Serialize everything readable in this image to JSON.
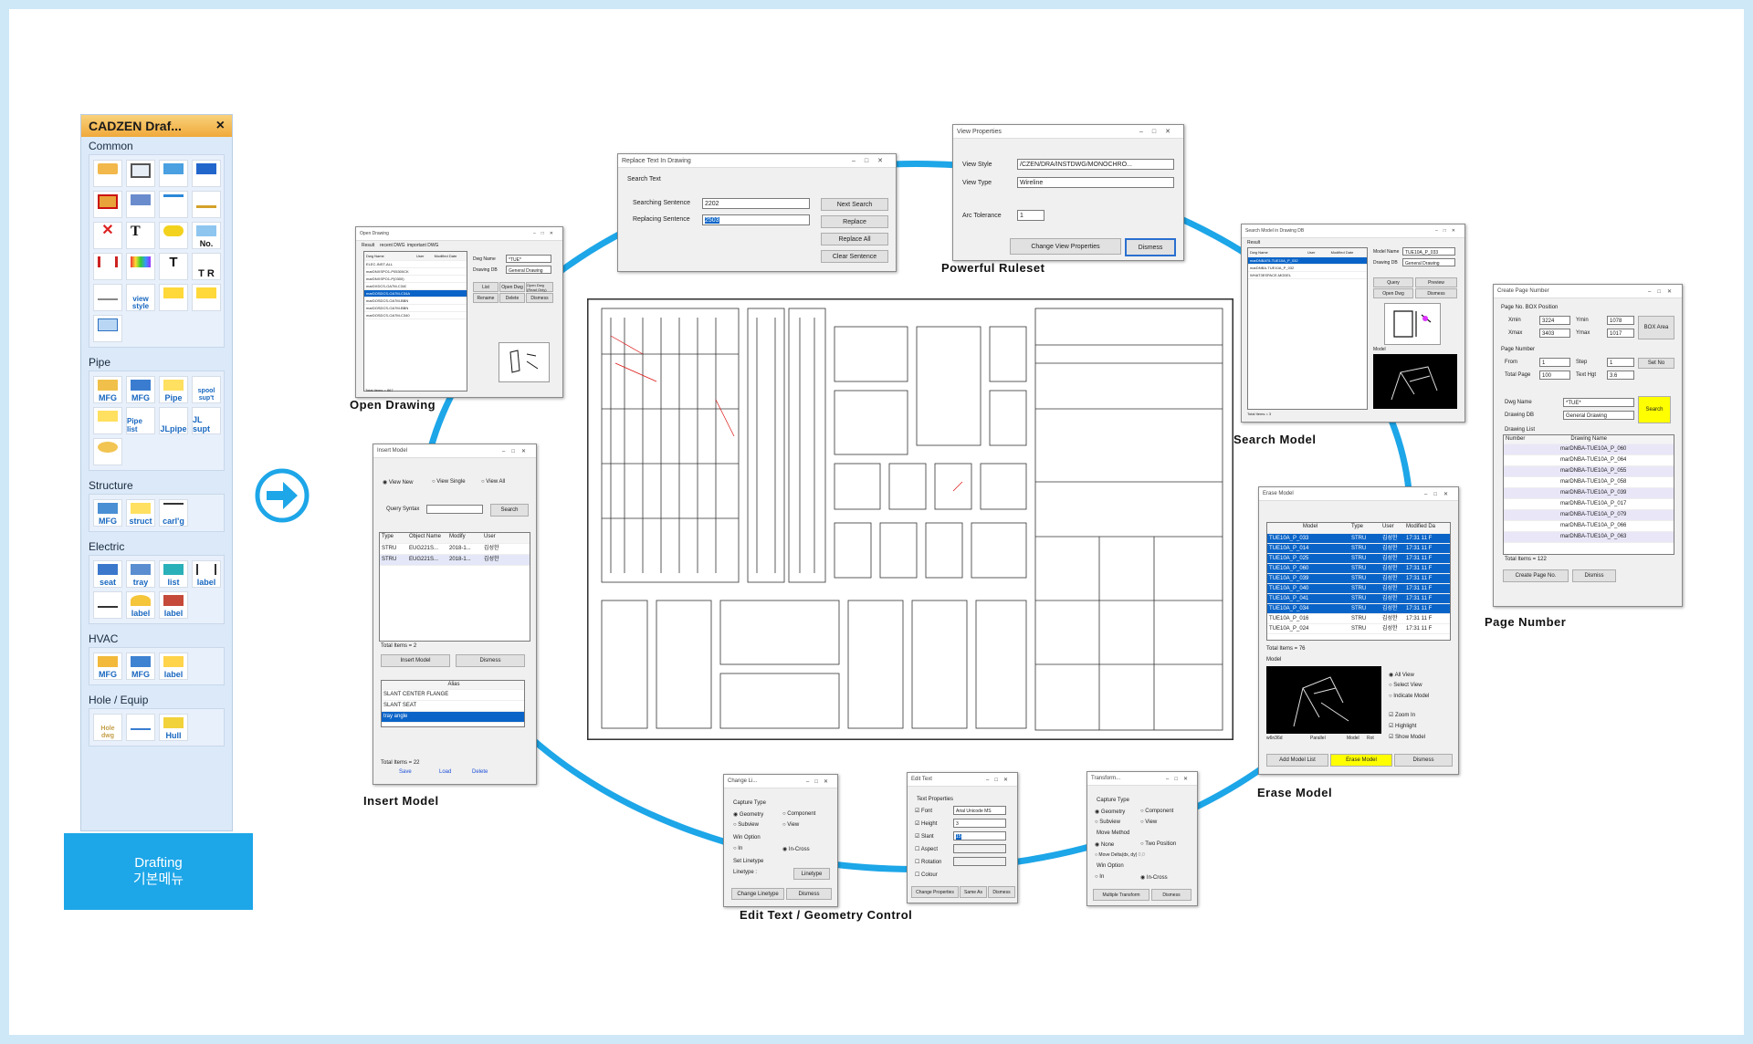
{
  "palette": {
    "title": "CADZEN Draf...",
    "close": "×",
    "sections": {
      "common": "Common",
      "pipe": "Pipe",
      "structure": "Structure",
      "electric": "Electric",
      "hvac": "HVAC",
      "hole": "Hole / Equip"
    },
    "tool_labels": {
      "common_3d": "3D",
      "common_no": "No.",
      "common_tr": "T R",
      "common_view": "view style",
      "pipe_mfg1": "MFG",
      "pipe_mfg2": "MFG",
      "pipe_pipe": "Pipe",
      "pipe_spool": "spool sup't",
      "pipe_list": "Pipe list",
      "pipe_jlpipe": "JLpipe",
      "pipe_jlsupt": "JL supt",
      "str_mfg": "MFG",
      "str_struct": "struct",
      "str_carl": "carl'g",
      "el_seat": "seat",
      "el_tray": "tray",
      "el_list": "list",
      "el_label1": "label",
      "el_label2": "label",
      "el_label3": "label",
      "hv_mfg1": "MFG",
      "hv_mfg2": "MFG",
      "hv_label": "label",
      "hole_dwg": "Hole dwg",
      "hole_hull": "Hull"
    }
  },
  "drafting_button": {
    "line1": "Drafting",
    "line2": "기본메뉴"
  },
  "captions": {
    "open_drawing": "Open Drawing",
    "powerful_ruleset": "Powerful Ruleset",
    "search_model": "Search Model",
    "page_number": "Page Number",
    "insert_model": "Insert Model",
    "erase_model": "Erase Model",
    "edit_text": "Edit Text / Geometry Control"
  },
  "replace_dialog": {
    "title": "Replace Text In Drawing",
    "group": "Search Text",
    "searching_label": "Searching Sentence",
    "searching_value": "2202",
    "replacing_label": "Replacing Sentence",
    "replacing_value": "2503",
    "next_search": "Next Search",
    "replace": "Replace",
    "replace_all": "Replace All",
    "clear": "Clear Sentence"
  },
  "view_dialog": {
    "title": "View Properties",
    "style_label": "View Style",
    "style_value": "/CZEN/DRA/INSTDWG/MONOCHRO...",
    "type_label": "View Type",
    "type_value": "Wireline",
    "arc_label": "Arc Tolerance",
    "arc_value": "1",
    "change": "Change View Properties",
    "dismiss": "Dismess"
  },
  "open_dialog": {
    "title": "Open Drawing",
    "tabs": [
      "Result",
      "recent DWG",
      "important DWG"
    ],
    "headers": [
      "Dwg Name",
      "User",
      "Modified Date"
    ],
    "rows": [
      "ELEC-INST-ALL",
      "marDNXSPO1-P05300CK",
      "marDNXSPO1-P(0300)",
      "marDXDCS-OA7M-C340",
      "marDOSDCS-OA7M-C34A",
      "marDOSDCS-OA7M-BBN",
      "marDOSDCS-OA7M-BBN",
      "marDOSDCS-OA7M-C340"
    ],
    "dwg_name_label": "Dwg Name",
    "dwg_name_value": "*TUE*",
    "drawing_db_label": "Drawing DB",
    "drawing_db_value": "General Drawing",
    "btn_list": "List",
    "btn_open": "Open Dwg",
    "btn_open_read": "Open Dwg (Read Only)",
    "btn_rename": "Rename",
    "btn_delete": "Delete",
    "btn_dismiss": "Dismess",
    "total": "Total Items = 867"
  },
  "search_dialog": {
    "title": "Search Model in Drawing DB",
    "group": "Result",
    "headers": [
      "Dwg Name",
      "User",
      "Modified Date"
    ],
    "rows": [
      "marDNBAT5-TUE10A_P_032",
      "marDNBA-TUE10A_P_032",
      "WHAT3ESPACE-MODEL"
    ],
    "model_label": "Model Name",
    "model_value": "TUE10A_P_033",
    "db_label": "Drawing DB",
    "db_value": "General Drawing",
    "query": "Query",
    "preview": "Preview",
    "open": "Open Dwg",
    "dismiss": "Dismess",
    "model_group": "Model",
    "total": "Total Items = 3"
  },
  "page_dialog": {
    "title": "Create Page Number",
    "box_group": "Page No. BOX Position",
    "xmin_label": "Xmin",
    "xmin": "3224",
    "ymin_label": "Ymin",
    "ymin": "1078",
    "xmax_label": "Xmax",
    "xmax": "3403",
    "ymax_label": "Ymax",
    "ymax": "1017",
    "box_area": "BOX Area",
    "pn_group": "Page Number",
    "from_label": "From",
    "from": "1",
    "step_label": "Step",
    "step": "1",
    "setno": "Set No",
    "total_label": "Total Page",
    "total_page": "100",
    "hgt_label": "Text Hgt",
    "hgt": "3.6",
    "dwg_label": "Dwg Name",
    "dwg_value": "*TUE*",
    "db_label": "Drawing DB",
    "db_value": "General Drawing",
    "search": "Search",
    "list_label": "Drawing List",
    "col_number": "Number",
    "col_name": "Drawing Name",
    "rows": [
      "marDNBA-TUE10A_P_060",
      "marDNBA-TUE10A_P_064",
      "marDNBA-TUE10A_P_055",
      "marDNBA-TUE10A_P_058",
      "marDNBA-TUE10A_P_039",
      "marDNBA-TUE10A_P_017",
      "marDNBA-TUE10A_P_079",
      "marDNBA-TUE10A_P_066",
      "marDNBA-TUE10A_P_063"
    ],
    "total": "Total Items = 122",
    "create": "Create Page No.",
    "dismiss": "Dismiss"
  },
  "insert_dialog": {
    "title": "Insert Model",
    "view_new": "View New",
    "view_single": "View Single",
    "view_all": "View All",
    "query_label": "Query Syntax",
    "search": "Search",
    "headers": [
      "Type",
      "Object Name",
      "Modify",
      "User"
    ],
    "rows": [
      [
        "STRU",
        "EUG221S...",
        "2018-1...",
        "김성한"
      ],
      [
        "STRU",
        "EUG221S...",
        "2018-1...",
        "김성한"
      ]
    ],
    "total": "Total Items = 2",
    "insert": "Insert Model",
    "dismiss": "Dismess",
    "alias_header": "Alias",
    "alias": [
      "SLANT CENTER FLANGE",
      "SLANT SEAT",
      "tray angle"
    ],
    "alias_total": "Total Items = 22",
    "save": "Save",
    "load": "Load",
    "delete": "Delete"
  },
  "erase_dialog": {
    "title": "Erase Model",
    "headers": [
      "Model",
      "Type",
      "User",
      "Modified Da"
    ],
    "rows": [
      "TUE10A_P_033",
      "TUE10A_P_014",
      "TUE10A_P_025",
      "TUE10A_P_060",
      "TUE10A_P_039",
      "TUE10A_P_040",
      "TUE10A_P_041",
      "TUE10A_P_034",
      "TUE10A_P_016",
      "TUE10A_P_024"
    ],
    "row_type": "STRU",
    "row_user": "김성한",
    "row_date": "17:31 11 F",
    "total": "Total Items = 76",
    "model_group": "Model",
    "all_view": "All View",
    "select_view": "Select View",
    "indicate": "Indicate Model",
    "zoom": "Zoom In",
    "highlight": "Highlight",
    "show": "Show Model",
    "view_w": "w6n36d",
    "view_p": "Parallel",
    "view_m": "Model",
    "view_r": "Rot",
    "add": "Add Model List",
    "erase": "Erase Model",
    "dismiss": "Dismess"
  },
  "change_dialog": {
    "title": "Change Li...",
    "capture": "Capture Type",
    "geometry": "Geometry",
    "component": "Component",
    "subview": "Subview",
    "view": "View",
    "win": "Win Option",
    "in": "In",
    "incross": "In-Cross",
    "setlt": "Set Linetype",
    "linetype_label": "Linetype :",
    "linetype_btn": "Linetype",
    "change": "Change Linetype",
    "dismiss": "Dismess"
  },
  "edittext_dialog": {
    "title": "Edit Text",
    "group": "Text Properties",
    "font": "Font",
    "font_value": "Arial Unicode MS",
    "height": "Height",
    "height_value": "3",
    "slant": "Slant",
    "slant_value": "15",
    "aspect": "Aspect",
    "rotation": "Rotation",
    "colour": "Colour",
    "change": "Change Properties",
    "same": "Same As",
    "dismiss": "Dismess"
  },
  "transform_dialog": {
    "title": "Transform...",
    "capture": "Capture Type",
    "geometry": "Geometry",
    "component": "Component",
    "subview": "Subview",
    "view": "View",
    "move": "Move Method",
    "none": "None",
    "two": "Two Position",
    "delta": "Move Delta(dx, dy)",
    "delta_value": "0,0",
    "win": "Win Option",
    "in": "In",
    "incross": "In-Cross",
    "multi": "Multiple Transform",
    "dismiss": "Dismess"
  },
  "colors": {
    "accent": "#1da6e8",
    "highlight": "#ffff00",
    "selection": "#0a64c8"
  }
}
